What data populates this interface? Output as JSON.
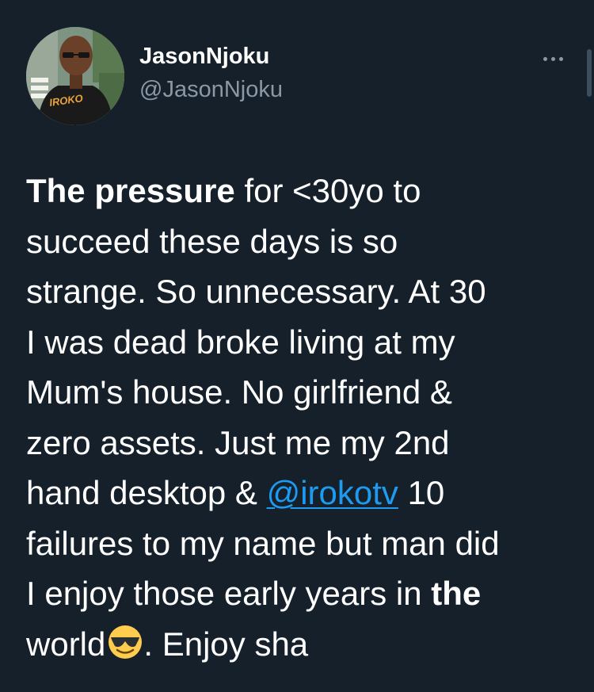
{
  "author": {
    "display_name": "JasonNjoku",
    "handle": "@JasonNjoku",
    "avatar_shirt_text": "IROKO"
  },
  "header": {
    "more_label": "•••"
  },
  "tweet": {
    "l1_bold": "The pressure",
    "l1_rest": " for <30yo to",
    "l2": "succeed these days is so",
    "l3": "strange. So unnecessary. At 30",
    "l4": "I was dead broke living at my",
    "l5": "Mum's house. No girlfriend &",
    "l6": "zero assets. Just me my 2nd",
    "l7_pre": "hand desktop & ",
    "l7_mention": "@irokotv",
    "l7_post": " 10",
    "l8": "failures to my name but man did",
    "l9_pre": "I enjoy those early years in ",
    "l9_bold": "the",
    "l10_pre": "world",
    "l10_emoji": "smiling-face-with-sunglasses-icon",
    "l10_post": ". Enjoy sha"
  },
  "colors": {
    "background": "#15202b",
    "text": "#ffffff",
    "secondary_text": "#8b98a5",
    "link": "#1d9bf0"
  }
}
